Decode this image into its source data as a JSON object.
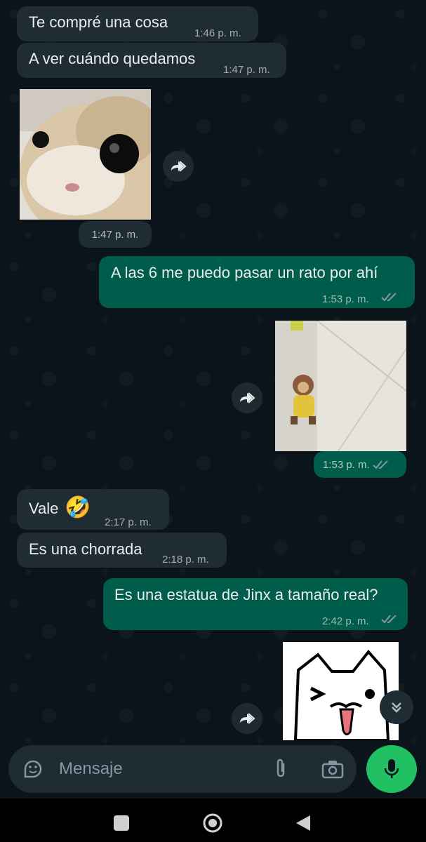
{
  "messages": [
    {
      "text": "Te compré una cosa",
      "time": "1:46 p. m."
    },
    {
      "text": "A ver cuándo quedamos",
      "time": "1:47 p. m."
    },
    {
      "time": "1:47 p. m."
    },
    {
      "text": "A las 6 me puedo pasar un rato por ahí",
      "time": "1:53 p. m."
    },
    {
      "time": "1:53 p. m."
    },
    {
      "text": "Vale",
      "emoji": "🤣",
      "time": "2:17 p. m."
    },
    {
      "text": "Es una chorrada",
      "time": "2:18 p. m."
    },
    {
      "text": "Es una estatua de Jinx a tamaño real?",
      "time": "2:42 p. m."
    }
  ],
  "composer": {
    "placeholder": "Mensaje"
  },
  "colors": {
    "background": "#0b141a",
    "incoming_bubble": "#202c33",
    "outgoing_bubble": "#005c4b",
    "accent_green": "#21c063"
  },
  "icons": [
    "forward-icon",
    "double-check-icon",
    "sticker-icon",
    "attach-icon",
    "camera-icon",
    "microphone-icon",
    "chevron-double-down-icon",
    "nav-recents-icon",
    "nav-home-icon",
    "nav-back-icon"
  ]
}
